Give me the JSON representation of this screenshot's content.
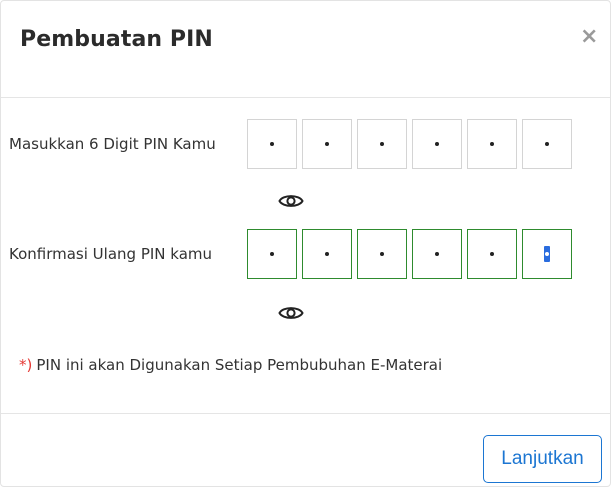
{
  "modal": {
    "title": "Pembuatan PIN",
    "close_icon": "×"
  },
  "pin_entry": {
    "label": "Masukkan 6 Digit PIN Kamu",
    "digits_filled": 6,
    "total_digits": 6,
    "toggle_icon": "eye-icon"
  },
  "pin_confirm": {
    "label": "Konfirmasi Ulang PIN kamu",
    "digits_filled": 6,
    "total_digits": 6,
    "active_digit": 6,
    "border_color": "#2e8b2e",
    "toggle_icon": "eye-icon"
  },
  "note": {
    "marker": "*)",
    "text": "PIN ini akan Digunakan Setiap Pembubuhan E-Materai",
    "marker_color": "#e53935"
  },
  "footer": {
    "primary_label": "Lanjutkan",
    "primary_color": "#1c76d2"
  }
}
